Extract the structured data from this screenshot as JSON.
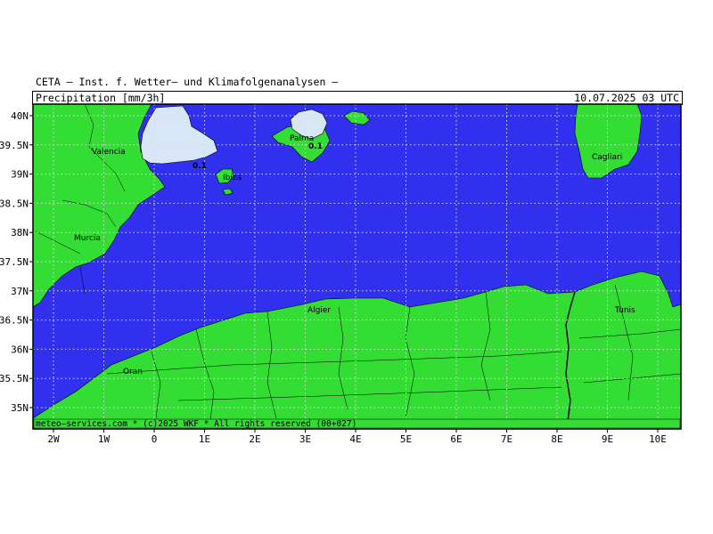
{
  "header": {
    "institute": "CETA — Inst. f. Wetter— und Klimafolgenanalysen —",
    "product": "Precipitation [mm/3h]",
    "datetime": "10.07.2025 03 UTC"
  },
  "footer": {
    "credit": "meteo—services.com * (c)2025 WKF * All rights reserved (00+027)"
  },
  "colors": {
    "sea": "#3030ee",
    "land": "#33dd33",
    "precip_light": "#d8e6f6",
    "border": "#000000",
    "grid": "#dddddd"
  },
  "axes": {
    "lon_ticks": [
      "2W",
      "1W",
      "0",
      "1E",
      "2E",
      "3E",
      "4E",
      "5E",
      "6E",
      "7E",
      "8E",
      "9E",
      "10E"
    ],
    "lat_ticks": [
      "40N",
      "39.5N",
      "39N",
      "38.5N",
      "38N",
      "37.5N",
      "37N",
      "36.5N",
      "36N",
      "35.5N",
      "35N"
    ]
  },
  "places": [
    {
      "name": "Valencia"
    },
    {
      "name": "Murcia"
    },
    {
      "name": "Ibiza"
    },
    {
      "name": "Palma"
    },
    {
      "name": "Cagliari"
    },
    {
      "name": "Algier"
    },
    {
      "name": "Tunis"
    },
    {
      "name": "Oran"
    }
  ],
  "precip_labels": [
    {
      "value": "0.1"
    },
    {
      "value": "0.1"
    }
  ]
}
